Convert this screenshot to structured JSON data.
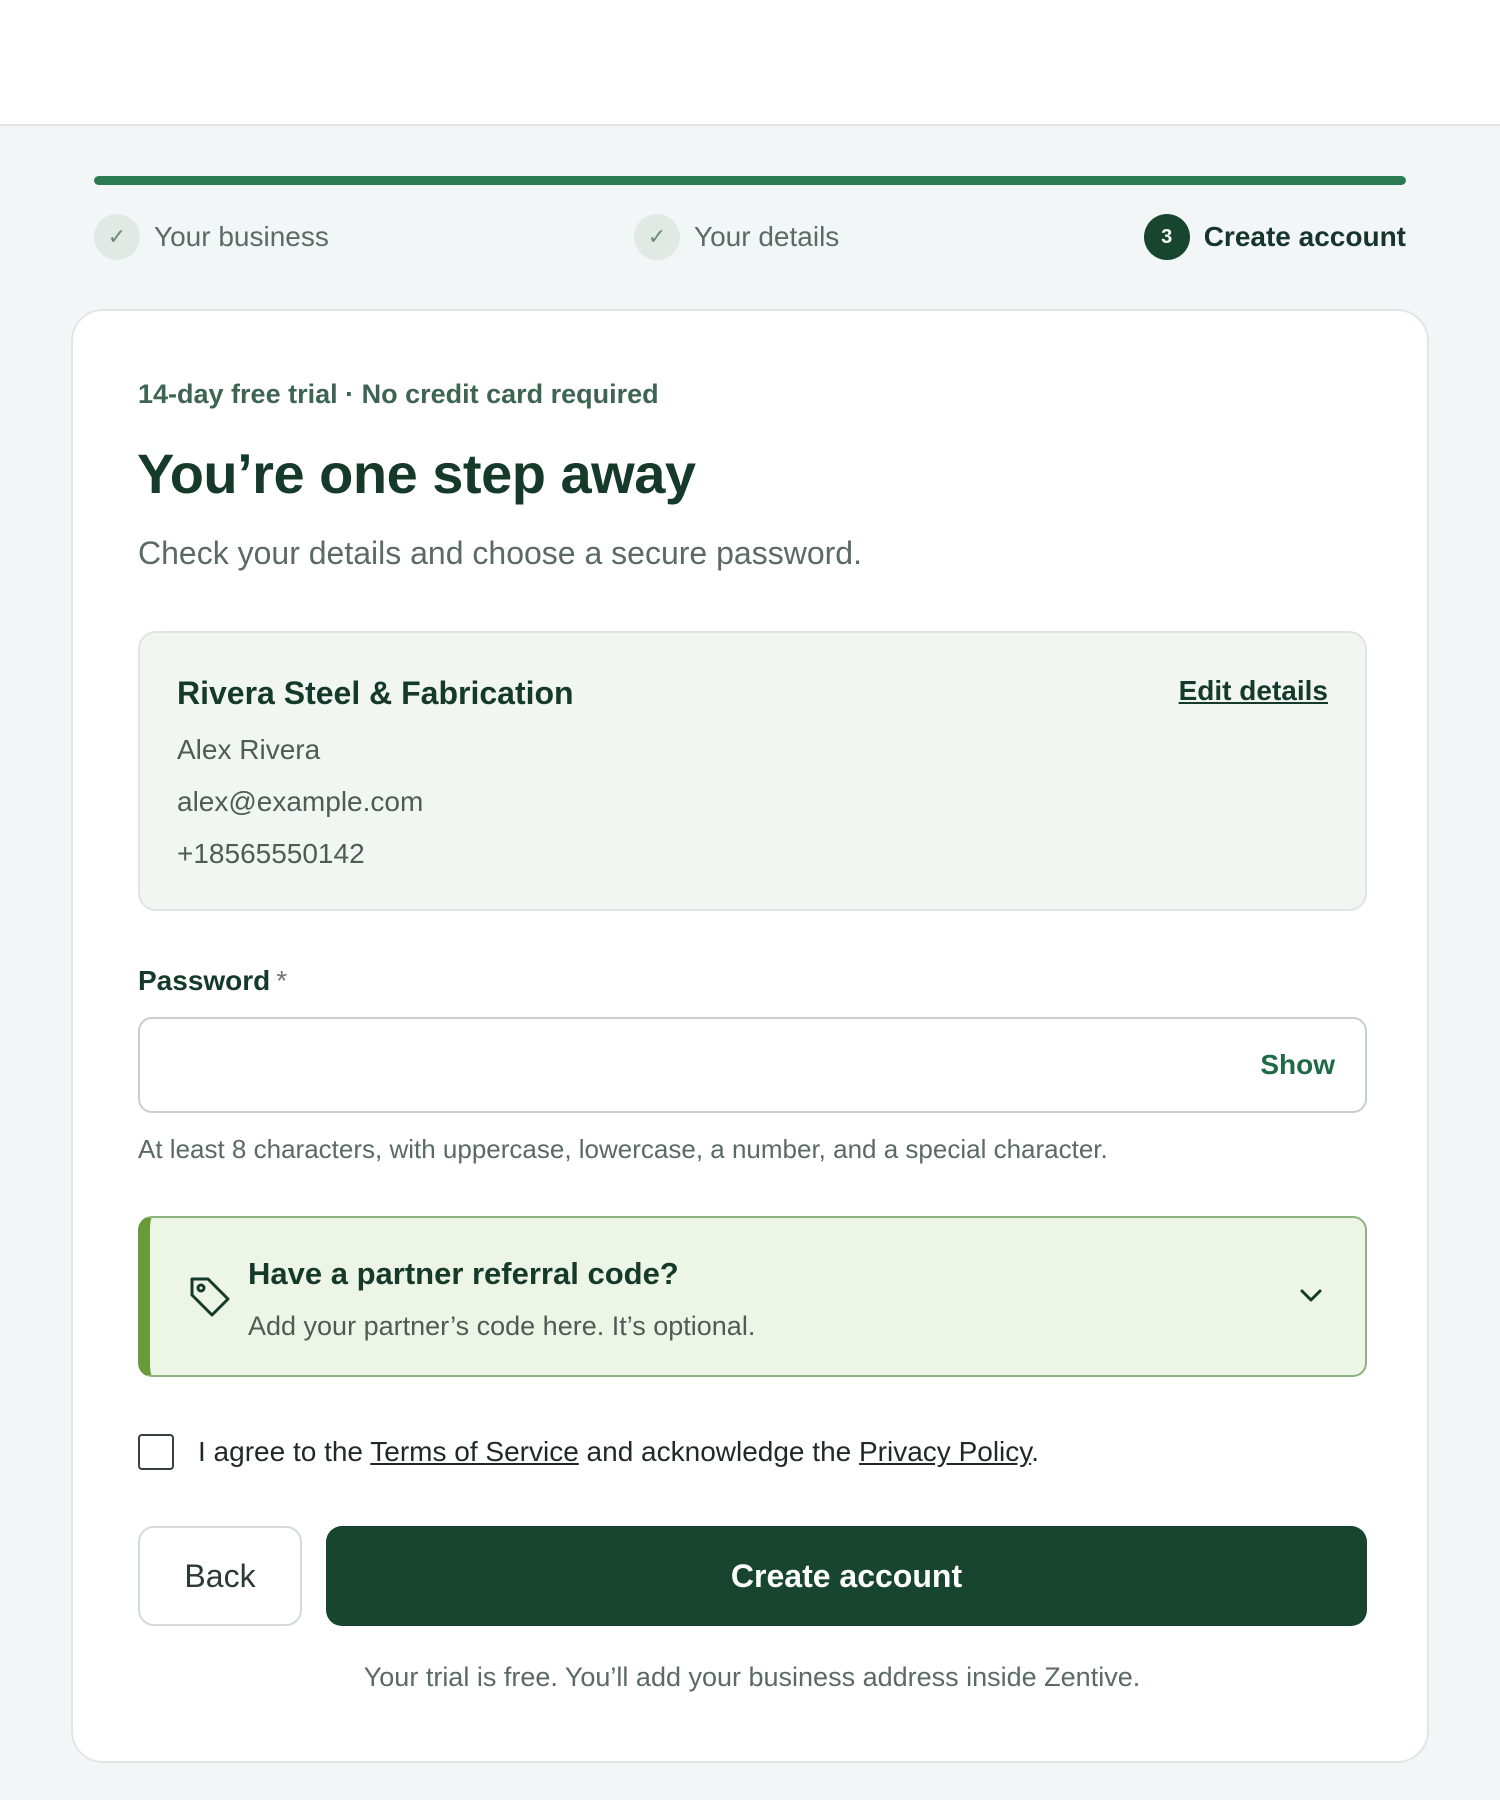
{
  "progress": {
    "fraction": 1.0
  },
  "steps": [
    {
      "label": "Your business",
      "marker": "✓",
      "state": "done"
    },
    {
      "label": "Your details",
      "marker": "✓",
      "state": "done"
    },
    {
      "label": "Create account",
      "marker": "3",
      "state": "current"
    }
  ],
  "card": {
    "eyebrow": "14-day free trial · No credit card required",
    "title": "You’re one step away",
    "subtitle": "Check your details and choose a secure password."
  },
  "summary": {
    "business_name": "Rivera Steel & Fabrication",
    "edit_label": "Edit details",
    "contact_name": "Alex Rivera",
    "email": "alex@example.com",
    "phone": "+18565550142"
  },
  "password": {
    "label": "Password",
    "required_mark": "*",
    "value": "",
    "show_label": "Show",
    "hint": "At least 8 characters, with uppercase, lowercase, a number, and a special character."
  },
  "referral": {
    "icon": "tag-icon",
    "title": "Have a partner referral code?",
    "subtitle": "Add your partner’s code here. It’s optional.",
    "expand_icon": "chevron-down-icon"
  },
  "agreement": {
    "prefix": "I agree to the ",
    "terms_label": "Terms of Service",
    "middle": " and acknowledge the ",
    "privacy_label": "Privacy Policy",
    "suffix": ".",
    "checked": false
  },
  "actions": {
    "back_label": "Back",
    "create_label": "Create account"
  },
  "footnote": "Your trial is free. You’ll add your business address inside Zentive.",
  "colors": {
    "brand_dark": "#17452f",
    "progress_green": "#2a7a52",
    "referral_accent": "#6a9a3a",
    "referral_bg": "#edf5e7",
    "page_bg": "#f3f6f6"
  }
}
